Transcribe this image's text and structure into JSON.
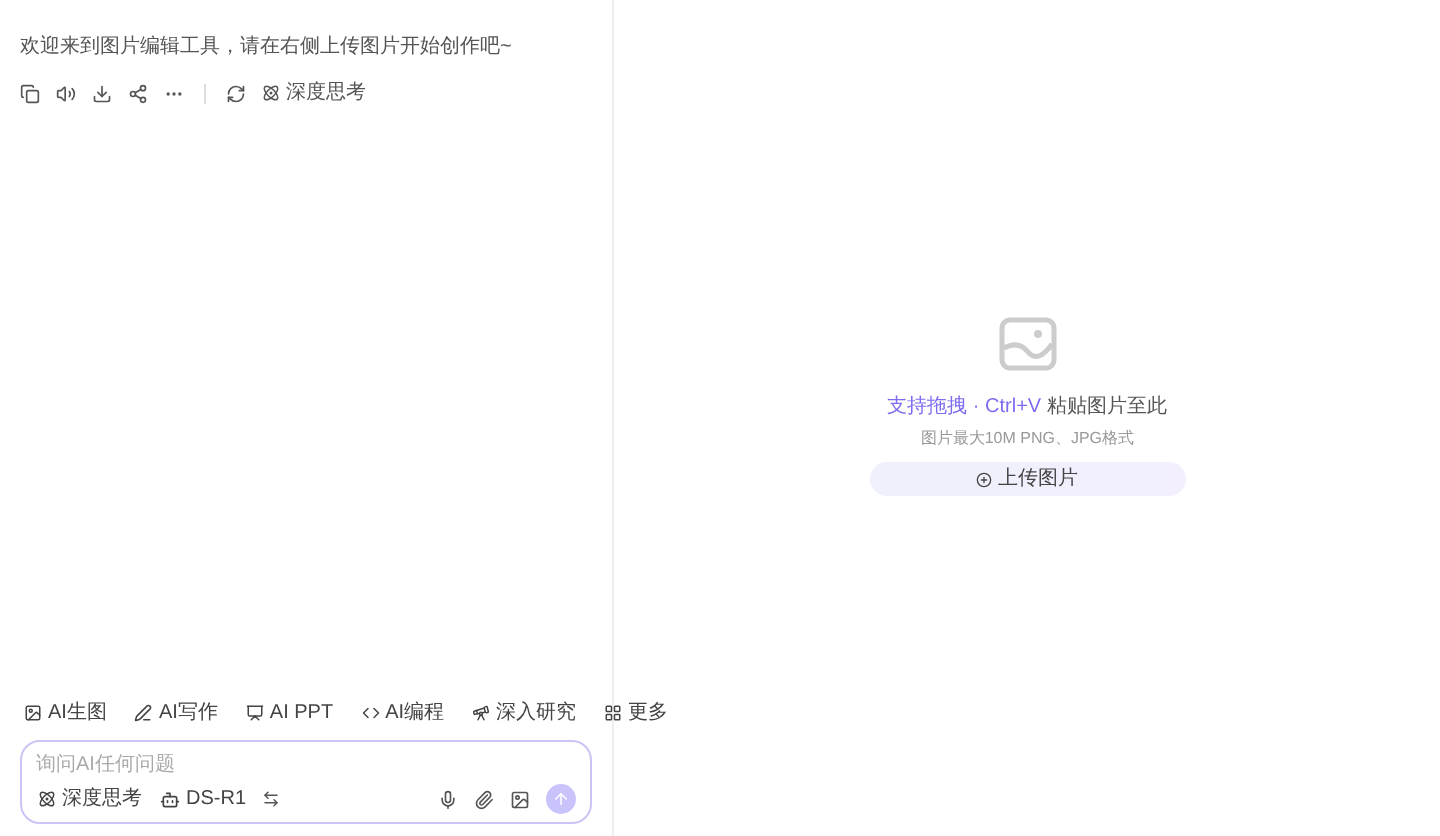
{
  "chat": {
    "message": "欢迎来到图片编辑工具，请在右侧上传图片开始创作吧~",
    "actions": [
      {
        "kind": "copy"
      },
      {
        "kind": "speak"
      },
      {
        "kind": "save"
      },
      {
        "kind": "share"
      },
      {
        "kind": "more"
      },
      {
        "kind": "divider"
      },
      {
        "kind": "regenerate"
      },
      {
        "kind": "deep",
        "label": "深度思考"
      }
    ],
    "tools": [
      {
        "kind": "image",
        "label": "AI生图"
      },
      {
        "kind": "write",
        "label": "AI写作"
      },
      {
        "kind": "ppt",
        "label": "AI PPT"
      },
      {
        "kind": "code",
        "label": "AI编程"
      },
      {
        "kind": "research",
        "label": "深入研究"
      },
      {
        "kind": "more",
        "label": "更多"
      }
    ],
    "input": {
      "placeholder": "询问AI任何问题",
      "deep_think": {
        "label": "深度思考",
        "on": false
      },
      "model": "DS-R1"
    }
  },
  "upload": {
    "hint_link": "支持拖拽 · Ctrl+V",
    "hint_rest": "粘贴图片至此",
    "limits": "图片最大10M PNG、JPG格式",
    "button": "上传图片"
  }
}
